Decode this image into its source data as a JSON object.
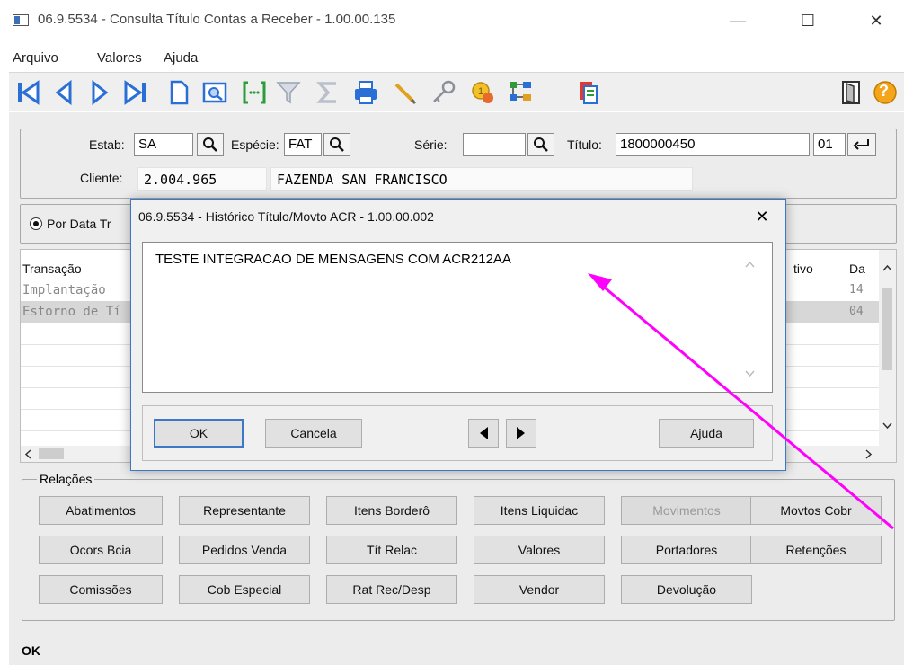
{
  "window": {
    "title": "06.9.5534 - Consulta Título Contas a Receber - 1.00.00.135",
    "minimize": "—",
    "maximize": "☐",
    "close": "✕"
  },
  "menu": [
    "Arquivo",
    "Valores",
    "Ajuda"
  ],
  "toolbar": {
    "icons": [
      "first-icon",
      "prev-icon",
      "next-icon",
      "last-icon",
      "new-doc-icon",
      "zoom-icon",
      "goto-icon",
      "filter-icon",
      "sum-icon",
      "print-icon",
      "edit-icon",
      "key-icon",
      "coins-icon",
      "tree-icon",
      "report-icon",
      "exit-door-icon",
      "help-icon"
    ],
    "help_label": "?"
  },
  "header": {
    "estab_label": "Estab:",
    "estab_value": "SA",
    "especie_label": "Espécie:",
    "especie_value": "FAT",
    "serie_label": "Série:",
    "serie_value": "",
    "titulo_label": "Título:",
    "titulo_value": "1800000450",
    "parcela_value": "01",
    "cliente_label": "Cliente:",
    "cliente_code": "2.004.965",
    "cliente_name": "FAZENDA SAN FRANCISCO"
  },
  "radio": {
    "por_data_label": "Por Data Tr"
  },
  "grid": {
    "col_transacao": "Transação",
    "col_ativo": "tivo",
    "col_da": "Da",
    "rows": [
      {
        "transacao": "Implantação",
        "da": "14"
      },
      {
        "transacao": "Estorno de Tí",
        "da": "04"
      }
    ]
  },
  "relacoes": {
    "title": "Relações",
    "row1": [
      "Abatimentos",
      "Representante",
      "Itens Borderô",
      "Itens Liquidac",
      "Movimentos",
      "Movtos Cobr"
    ],
    "row2": [
      "Ocors Bcia",
      "Pedidos Venda",
      "Tít Relac",
      "Valores",
      "Portadores",
      "Retenções"
    ],
    "row3": [
      "Comissões",
      "Cob Especial",
      "Rat Rec/Desp",
      "Vendor",
      "Devolução"
    ]
  },
  "status": {
    "text": "OK"
  },
  "dialog": {
    "title": "06.9.5534 - Histórico Título/Movto ACR - 1.00.00.002",
    "close": "✕",
    "memo_text": "TESTE INTEGRACAO DE MENSAGENS COM ACR212AA",
    "ok_label": "OK",
    "cancel_label": "Cancela",
    "help_label": "Ajuda"
  },
  "colors": {
    "arrow": "#ff00ff",
    "dialog_border": "#3b78c8",
    "nav_blue": "#2a6fd6"
  }
}
